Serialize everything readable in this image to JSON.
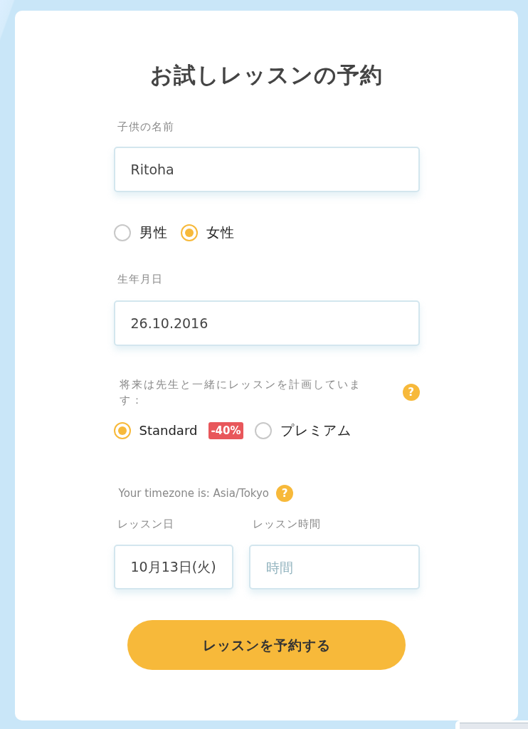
{
  "form": {
    "title": "お試しレッスンの予約",
    "child_name": {
      "label": "子供の名前",
      "value": "Ritoha"
    },
    "gender": {
      "options": [
        {
          "label": "男性",
          "selected": false
        },
        {
          "label": "女性",
          "selected": true
        }
      ]
    },
    "birth_date": {
      "label": "生年月日",
      "value": "26.10.2016"
    },
    "plan": {
      "question": "将来は先生と一緒にレッスンを計画しています：",
      "help": "?",
      "options": [
        {
          "label": "Standard",
          "badge": "-40%",
          "selected": true
        },
        {
          "label": "プレミアム",
          "selected": false
        }
      ]
    },
    "timezone": {
      "text": "Your timezone is: Asia/Tokyo",
      "help": "?"
    },
    "lesson_date": {
      "label": "レッスン日",
      "value": "10月13日(火)"
    },
    "lesson_time": {
      "label": "レッスン時間",
      "placeholder": "時間"
    },
    "submit_button": "レッスンを予約する"
  }
}
